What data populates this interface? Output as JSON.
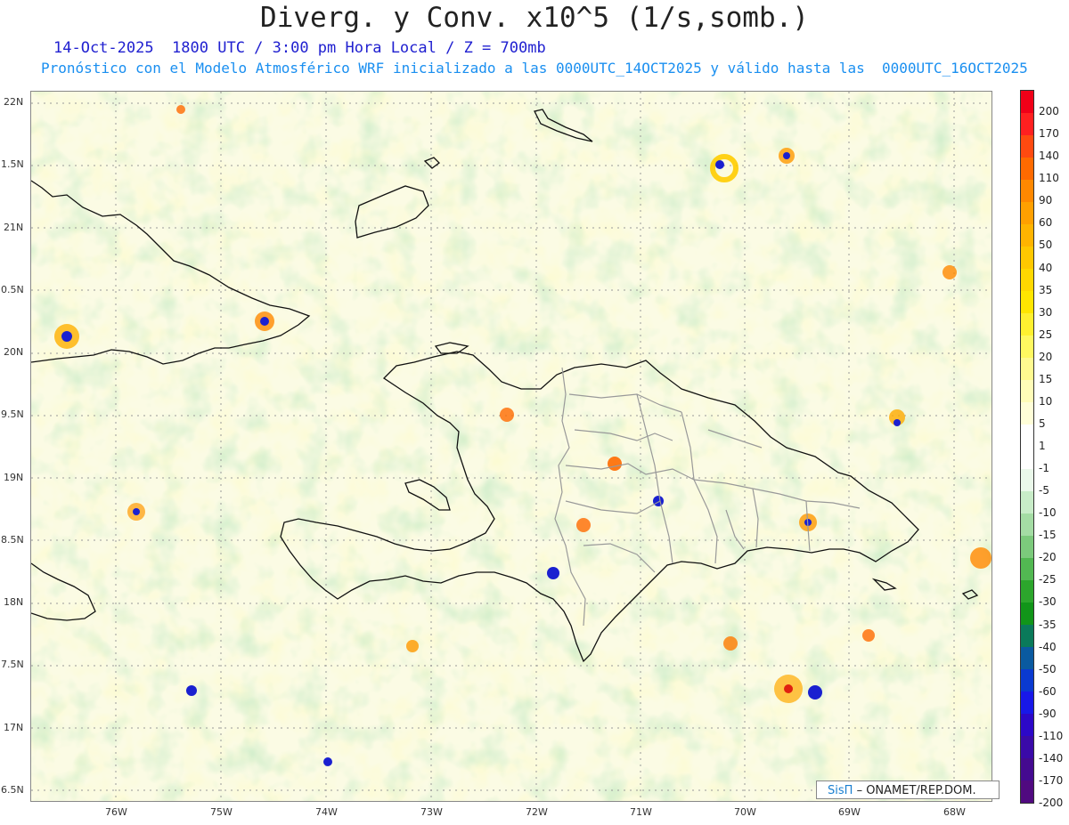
{
  "header": {
    "title": "Diverg. y Conv. x10^5 (1/s,somb.)",
    "date_line": "14-Oct-2025  1800 UTC / 3:00 pm Hora Local / Z = 700mb",
    "model_line": "Pronóstico con el Modelo Atmosférico WRF inicializado a las 0000UTC_14OCT2025 y válido hasta las  0000UTC_16OCT2025"
  },
  "map": {
    "lat_labels": [
      "22N",
      "1.5N",
      "21N",
      "0.5N",
      "20N",
      "9.5N",
      "19N",
      "8.5N",
      "18N",
      "7.5N",
      "17N",
      "6.5N"
    ],
    "lon_labels": [
      "76W",
      "75W",
      "74W",
      "73W",
      "72W",
      "71W",
      "70W",
      "69W",
      "68W"
    ]
  },
  "colorbar": {
    "labels": [
      "200",
      "170",
      "140",
      "110",
      "90",
      "60",
      "50",
      "40",
      "35",
      "30",
      "25",
      "20",
      "15",
      "10",
      "5",
      "1",
      "-1",
      "-5",
      "-10",
      "-15",
      "-20",
      "-25",
      "-30",
      "-35",
      "-40",
      "-50",
      "-60",
      "-90",
      "-110",
      "-140",
      "-170",
      "-200"
    ],
    "colors": [
      "#f00018",
      "#ff2020",
      "#ff4a10",
      "#ff6a00",
      "#ff8800",
      "#ffa000",
      "#ffb400",
      "#ffc800",
      "#ffd800",
      "#ffe600",
      "#fff030",
      "#fff860",
      "#fffa90",
      "#fffcb8",
      "#fffed8",
      "#ffffff",
      "#ffffff",
      "#eaf8ea",
      "#c8ecc8",
      "#a4dca4",
      "#7cca7c",
      "#52b852",
      "#2ca62c",
      "#119519",
      "#0a7a5a",
      "#0a5aa0",
      "#0a3ad0",
      "#1818e8",
      "#2c08c8",
      "#3a0aa8",
      "#440a90",
      "#500a80"
    ]
  },
  "credit": {
    "brand": "SisΠ",
    "text": "– ONAMET/REP.DOM."
  }
}
